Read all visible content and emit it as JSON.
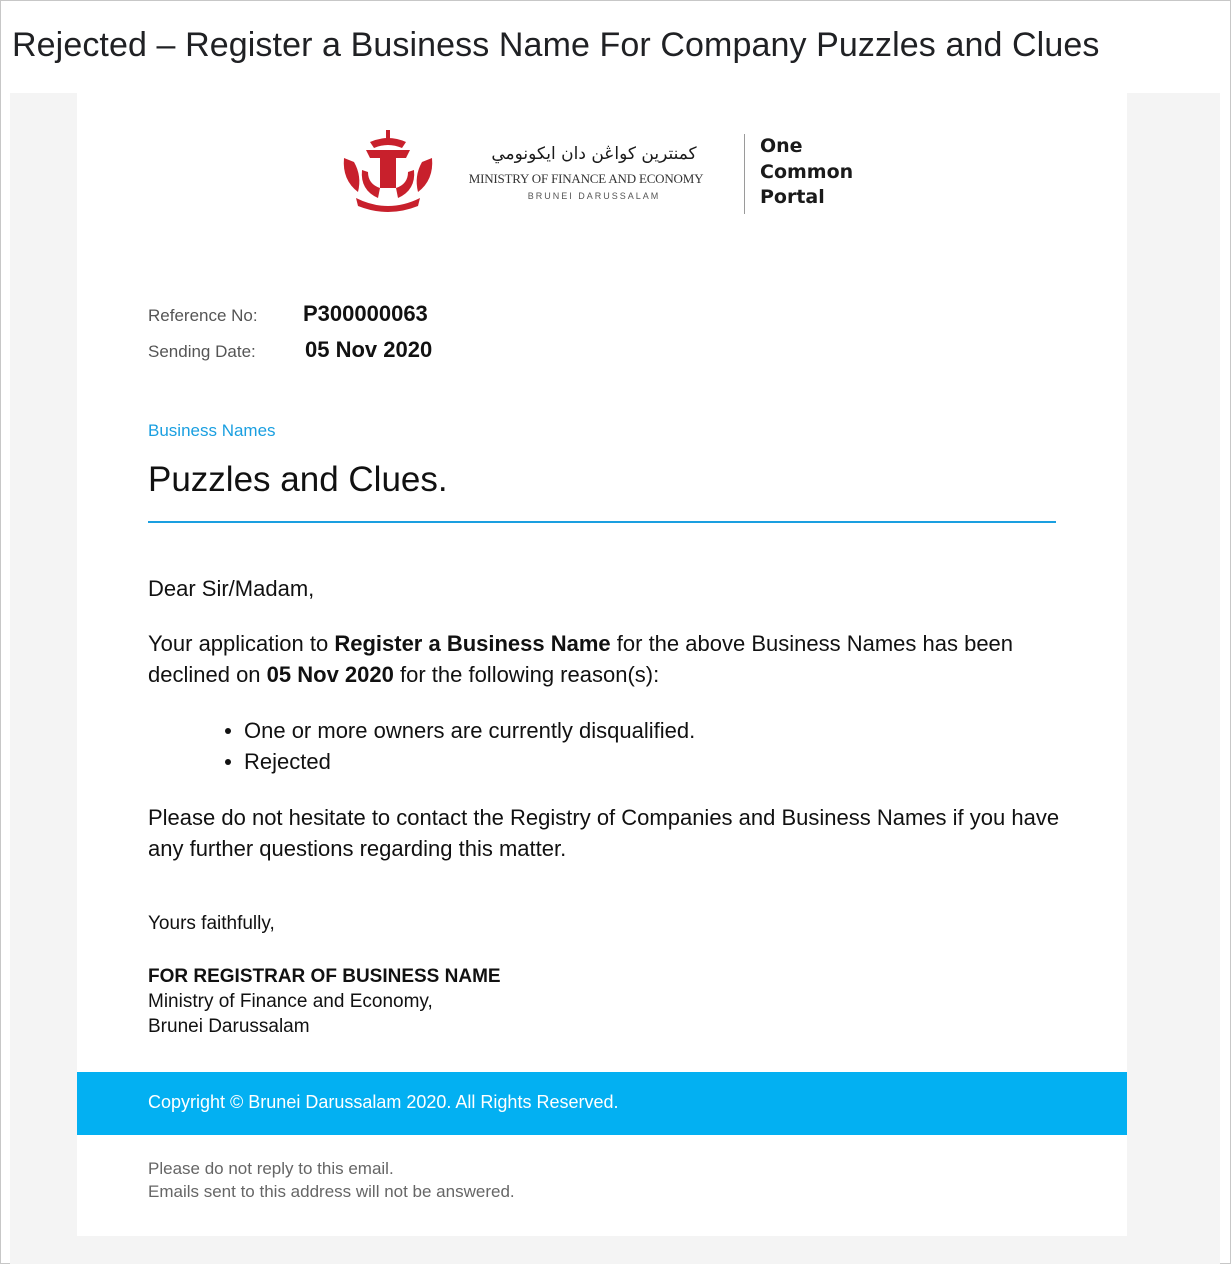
{
  "email": {
    "subject": "Rejected – Register a Business Name For Company Puzzles and Clues"
  },
  "header": {
    "ministry_arabic": "كمنترين كواڠن دان ايكونومي",
    "ministry_english": "MINISTRY OF FINANCE AND ECONOMY",
    "ministry_country": "BRUNEI DARUSSALAM",
    "portal_line1": "One",
    "portal_line2": "Common",
    "portal_line3": "Portal",
    "crest_color": "#c8202c"
  },
  "meta": {
    "reference_label": "Reference No:",
    "reference_value": "P300000063",
    "date_label": "Sending Date:",
    "date_value": "05 Nov 2020"
  },
  "section": {
    "tag": "Business Names",
    "title": "Puzzles and Clues.",
    "accent_color": "#1a9fe0"
  },
  "letter": {
    "greeting": "Dear Sir/Madam,",
    "para1_a": "Your application to ",
    "para1_b": "Register a Business Name",
    "para1_c": " for the above Business Names has been declined on ",
    "para1_d": "05 Nov 2020",
    "para1_e": " for the following reason(s):",
    "reasons": [
      "One or more owners are currently disqualified.",
      "Rejected"
    ],
    "para2": "Please do not hesitate to contact the Registry of Companies and Business Names if you have any further questions regarding this matter.",
    "closing": "Yours faithfully,",
    "signature_title": "FOR REGISTRAR OF BUSINESS NAME",
    "signature_line1": "Ministry of Finance and Economy,",
    "signature_line2": "Brunei Darussalam"
  },
  "footer": {
    "copyright": "Copyright © Brunei Darussalam 2020. All Rights Reserved.",
    "bar_color": "#03b0f2",
    "noreply_line1": "Please do not reply to this email.",
    "noreply_line2": "Emails sent to this address will not be answered."
  }
}
